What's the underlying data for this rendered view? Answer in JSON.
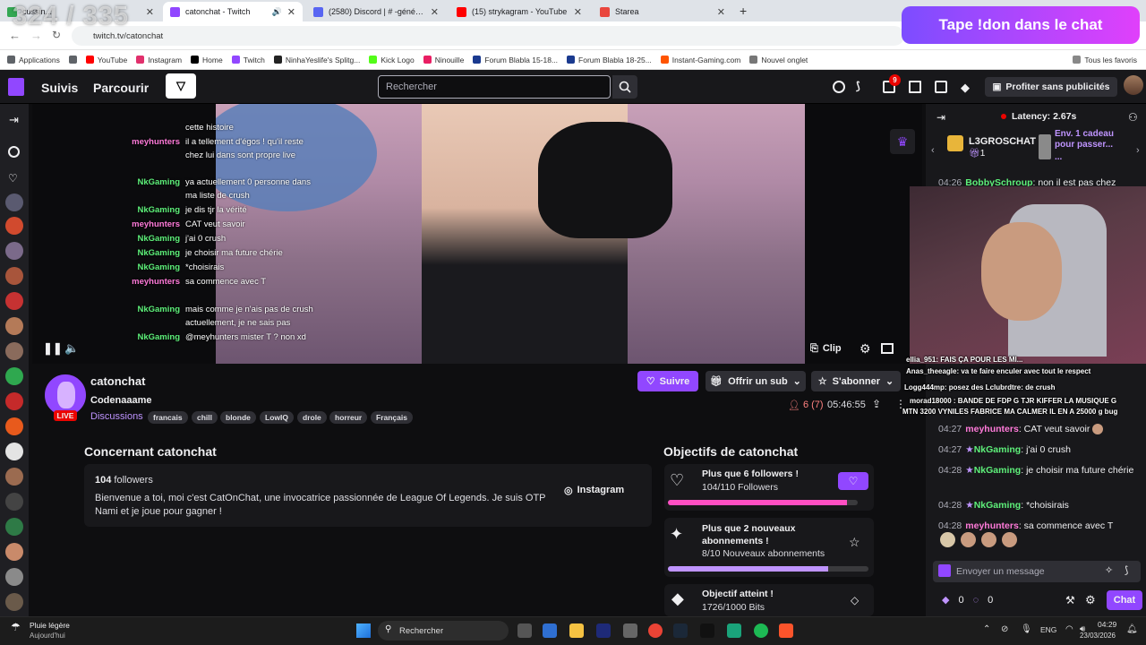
{
  "overlay": {
    "counter": "324 / 335",
    "donate_banner": "Tape !don dans le chat"
  },
  "browser": {
    "tabs": [
      {
        "title": "cussin...",
        "color": "#34a853"
      },
      {
        "title": "catonchat - Twitch",
        "color": "#9147ff"
      },
      {
        "title": "(2580) Discord | # -général |",
        "color": "#5865f2"
      },
      {
        "title": "(15) strykagram - YouTube",
        "color": "#ff0000"
      },
      {
        "title": "Starea",
        "color": "#e9463d"
      }
    ],
    "url": "twitch.tv/catonchat",
    "bookmarks": [
      {
        "label": "Applications",
        "color": "#5f6368"
      },
      {
        "label": "YouTube",
        "color": "#ff0000"
      },
      {
        "label": "Instagram",
        "color": "#e1306c"
      },
      {
        "label": "Home",
        "color": "#000000"
      },
      {
        "label": "Twitch",
        "color": "#9147ff"
      },
      {
        "label": "NinhaYeslife's Splitg...",
        "color": "#222222"
      },
      {
        "label": "Kick Logo",
        "color": "#53fc18"
      },
      {
        "label": "Ninouille",
        "color": "#e91e63"
      },
      {
        "label": "Forum Blabla 15-18...",
        "color": "#1a3a8f"
      },
      {
        "label": "Forum Blabla 18-25...",
        "color": "#1a3a8f"
      },
      {
        "label": "Instant-Gaming.com",
        "color": "#ff5400"
      },
      {
        "label": "Nouvel onglet",
        "color": "#777777"
      }
    ],
    "all_bookmarks": "Tous les favoris"
  },
  "twitch_nav": {
    "following": "Suivis",
    "browse": "Parcourir",
    "search_placeholder": "Rechercher",
    "notif_badge": "9",
    "ad_free": "Profiter sans publicités"
  },
  "video": {
    "chat_overlay": [
      {
        "user": "",
        "text": "cette histoire",
        "color": "p"
      },
      {
        "user": "meyhunters",
        "text": "il a tellement d'égos ! qu'il reste",
        "color": "p"
      },
      {
        "user": "",
        "text": "chez lui dans sont propre live",
        "color": "p"
      },
      {
        "user": "NkGaming",
        "text": "ya actuellement 0 personne dans",
        "color": "g"
      },
      {
        "user": "",
        "text": "ma liste de crush",
        "color": "g"
      },
      {
        "user": "NkGaming",
        "text": "je dis tjr la vérité",
        "color": "g"
      },
      {
        "user": "meyhunters",
        "text": "CAT veut savoir",
        "color": "p"
      },
      {
        "user": "NkGaming",
        "text": "j'ai 0 crush",
        "color": "g"
      },
      {
        "user": "NkGaming",
        "text": "je choisir ma future chérie",
        "color": "g"
      },
      {
        "user": "NkGaming",
        "text": "*choisirais",
        "color": "g"
      },
      {
        "user": "meyhunters",
        "text": "sa commence avec T",
        "color": "p"
      },
      {
        "user": "NkGaming",
        "text": "mais comme je n'ais pas de crush",
        "color": "g"
      },
      {
        "user": "",
        "text": "actuellement, je ne sais pas",
        "color": "g"
      },
      {
        "user": "NkGaming",
        "text": "@meyhunters mister T ? non xd",
        "color": "g"
      }
    ],
    "clip": "Clip"
  },
  "channel": {
    "name": "catonchat",
    "title": "Codenaaame",
    "category": "Discussions",
    "live": "LIVE",
    "tags": [
      "francais",
      "chill",
      "blonde",
      "LowIQ",
      "drole",
      "horreur",
      "Français"
    ],
    "follow": "Suivre",
    "gift_sub": "Offrir un sub",
    "subscribe": "S'abonner",
    "viewers": "6 (7)",
    "uptime": "05:46:55"
  },
  "about": {
    "heading": "Concernant catonchat",
    "followers_count": "104",
    "followers_label": "followers",
    "bio": "Bienvenue a toi, moi c'est CatOnChat, une invocatrice passionnée de League Of Legends. Je suis OTP Nami et je joue pour gagner !",
    "instagram": "Instagram"
  },
  "goals": {
    "heading": "Objectifs de catonchat",
    "items": [
      {
        "title": "Plus que 6 followers !",
        "progress": "104/110 Followers",
        "fraction": 0.945,
        "color": "#ff4fc3"
      },
      {
        "title": "Plus que 2 nouveaux abonnements !",
        "progress": "8/10 Nouveaux abonnements",
        "fraction": 0.8,
        "color": "#bf94ff"
      },
      {
        "title": "Objectif atteint !",
        "progress": "1726/1000 Bits",
        "fraction": 1.0,
        "color": "#9147ff"
      }
    ]
  },
  "chat": {
    "latency": "Latency: 2.67s",
    "gifter_name": "L3GROSCHAT",
    "gifter_count": "1",
    "gift_promo": "Env. 1 cadeau pour passer...",
    "gift_promo2": "...",
    "messages": [
      {
        "time": "04:26",
        "user": "BobbySchroup",
        "text": "non il est pas chez",
        "color": "g"
      },
      {
        "time": "04:27",
        "user": "meyhunters",
        "text": "CAT veut savoir",
        "color": "p"
      },
      {
        "time": "04:27",
        "user": "NkGaming",
        "text": "j'ai 0 crush",
        "color": "g"
      },
      {
        "time": "04:28",
        "user": "NkGaming",
        "text": "je choisir ma future chérie",
        "color": "g"
      },
      {
        "time": "04:28",
        "user": "NkGaming",
        "text": "*choisirais",
        "color": "g"
      },
      {
        "time": "04:28",
        "user": "meyhunters",
        "text": "sa commence avec T",
        "color": "p"
      }
    ],
    "overlay_lines": [
      "ellia_951: FAIS ÇA POUR LES MI...",
      "Anas_theeagle: va te faire enculer avec tout le respect",
      "Logg444mp: posez des Lclubrdtre: de crush",
      "morad18000 : BANDE DE FDP G TJR KIFFER LA MUSIQUE G",
      "MTN 3200 VYNILES FABRICE MA CALMER IL EN A 25000 g bug"
    ],
    "input_placeholder": "Envoyer un message",
    "bits": "0",
    "points": "0",
    "send": "Chat"
  },
  "taskbar": {
    "weather": "Pluie légère",
    "weather_sub": "Aujourd'hui",
    "search": "Rechercher",
    "lang": "ENG",
    "time": "04:29",
    "date": "23/03/2026"
  }
}
